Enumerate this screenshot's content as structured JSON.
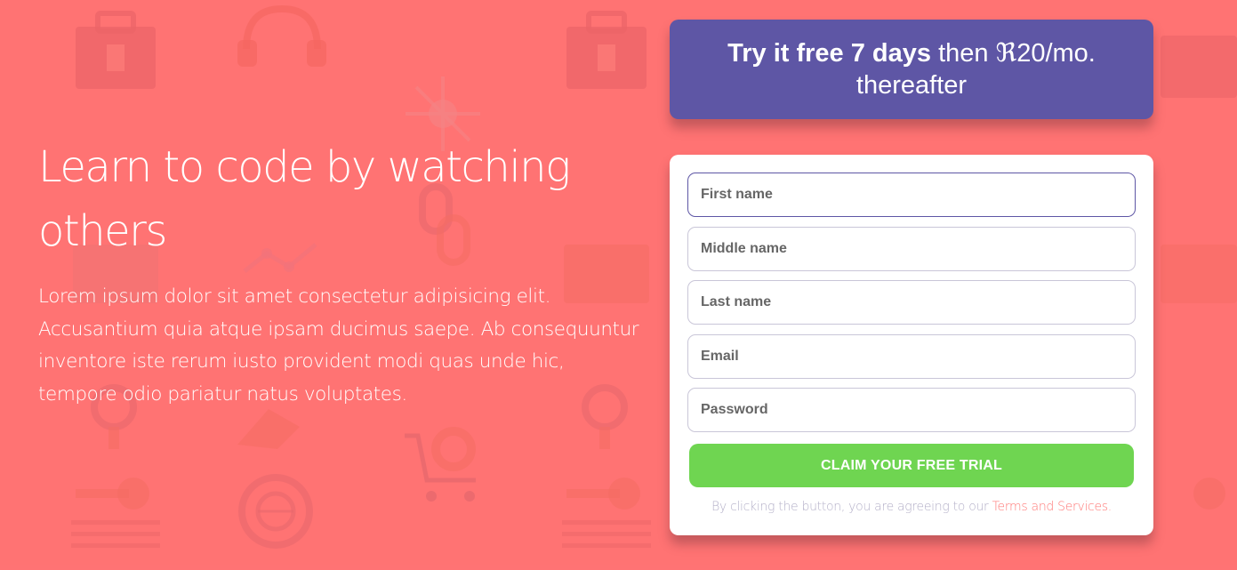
{
  "colors": {
    "background": "#ff7a78",
    "offer_box": "#5e56a5",
    "cta": "#6fd551",
    "link": "#ff7a78"
  },
  "hero": {
    "title": "Learn to code by watching others",
    "body": "Lorem ipsum dolor sit amet consectetur adipisicing elit. Accusantium quia atque ipsam ducimus saepe. Ab consequuntur inventore iste rerum iusto provident modi quas unde hic, tempore odio pariatur natus voluptates."
  },
  "offer": {
    "bold": "Try it free 7 days",
    "rest": " then ℜ20/mo. thereafter"
  },
  "form": {
    "first_name_placeholder": "First name",
    "middle_name_placeholder": "Middle name",
    "last_name_placeholder": "Last name",
    "email_placeholder": "Email",
    "password_placeholder": "Password",
    "submit_label": "CLAIM YOUR FREE TRIAL",
    "terms_text": "By clicking the button, you are agreeing to our ",
    "terms_link": "Terms and Services."
  },
  "background_icons": [
    "toolbox-icon",
    "headset-icon",
    "network-icon",
    "chain-link-icon",
    "graph-icon",
    "gear-icon",
    "key-icon",
    "globe-icon",
    "shopping-cart-icon",
    "rocket-icon",
    "magnifier-icon",
    "folder-icon"
  ]
}
